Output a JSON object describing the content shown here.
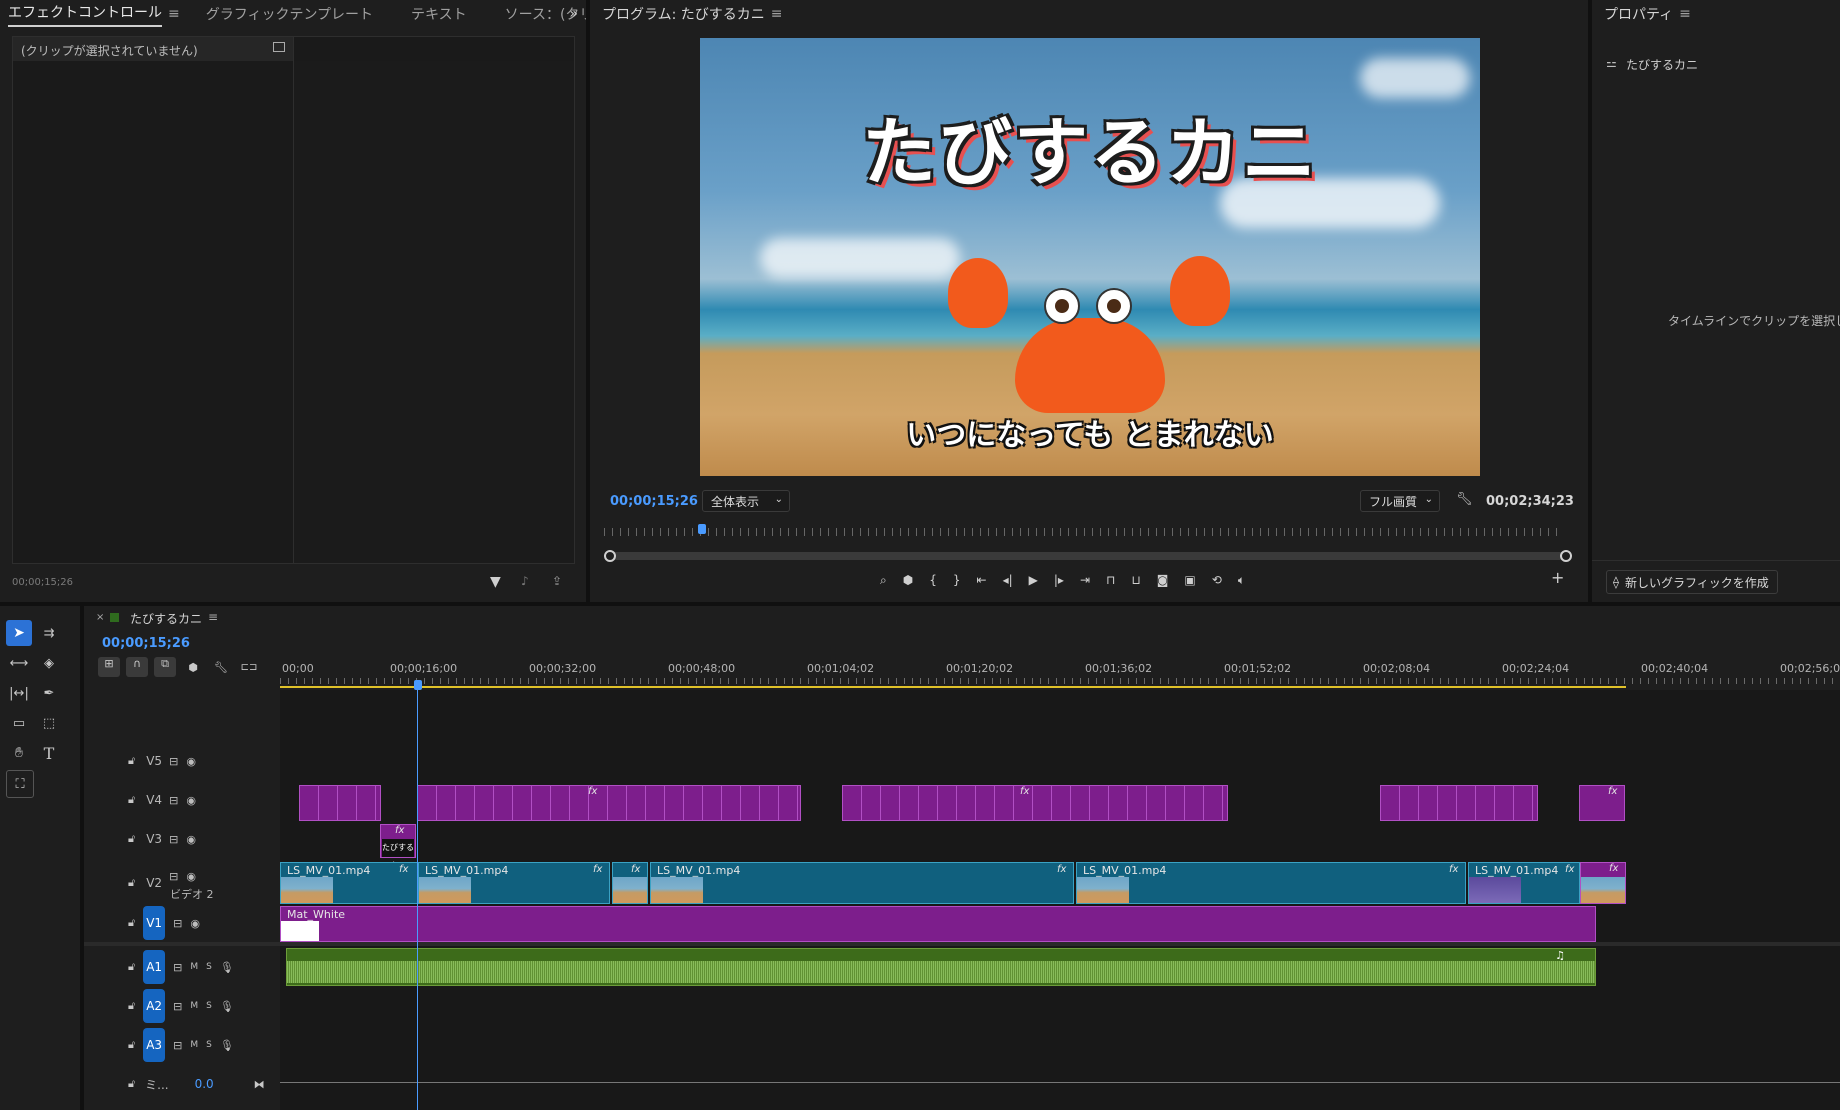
{
  "effect_panel": {
    "tabs": [
      "エフェクトコントロール",
      "グラフィックテンプレート",
      "テキスト",
      "ソース：(クリップなし)"
    ],
    "empty_message": "(クリップが選択されていません)",
    "timecode": "00;00;15;26"
  },
  "program_panel": {
    "title": "プログラム: たびするカニ",
    "current_timecode": "00;00;15;26",
    "zoom_select": "全体表示",
    "quality_select": "フル画質",
    "duration": "00;02;34;23",
    "video_title": "たびするカニ",
    "video_subtitle": "いつになっても とまれない"
  },
  "properties_panel": {
    "title": "プロパティ",
    "item_name": "たびするカニ",
    "hint": "タイムラインでクリップを選択し",
    "new_graphic_button": "新しいグラフィックを作成"
  },
  "timeline": {
    "sequence_name": "たびするカニ",
    "timecode": "00;00;15;26",
    "ruler_labels": [
      "00;00",
      "00;00;16;00",
      "00;00;32;00",
      "00;00;48;00",
      "00;01;04;02",
      "00;01;20;02",
      "00;01;36;02",
      "00;01;52;02",
      "00;02;08;04",
      "00;02;24;04",
      "00;02;40;04",
      "00;02;56;0"
    ],
    "video_tracks": [
      "V5",
      "V4",
      "V3",
      "V2",
      "V1"
    ],
    "v2_label": "ビデオ 2",
    "audio_tracks": [
      "A1",
      "A2",
      "A3"
    ],
    "mix_label": "ミ...",
    "mix_value": "0.0",
    "clip_name_v2": "LS_MV_01.mp4",
    "clip_name_v1": "Mat_White",
    "fx_label": "fx",
    "mute_label": "M",
    "solo_label": "S"
  },
  "colors": {
    "accent_blue": "#4a9bff",
    "clip_purple": "#7d1e8c",
    "clip_blue": "#10607e",
    "audio_green": "#3d6b1a",
    "in_out_yellow": "#e0c22a"
  }
}
